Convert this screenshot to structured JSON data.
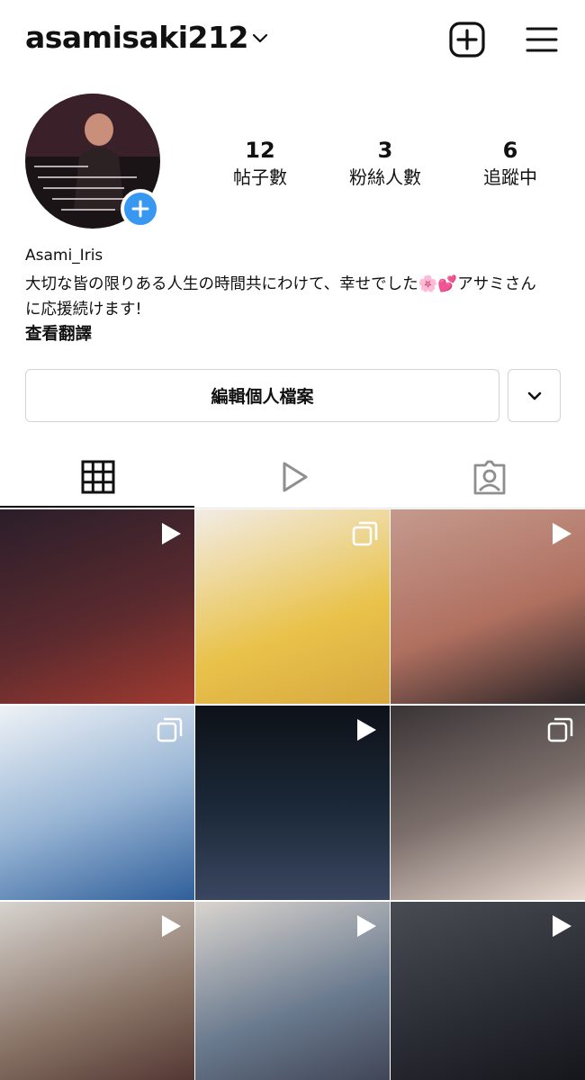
{
  "header": {
    "username": "asamisaki212",
    "icons": [
      "chevron-down-icon",
      "plus-square-icon",
      "hamburger-menu-icon"
    ]
  },
  "profile": {
    "display_name": "Asami_Iris",
    "bio_line1": "大切な皆の限りある人生の時間共にわけて、幸せでした🌸💕アサミさん",
    "bio_line2": "に応援続けます!",
    "translate_label": "查看翻譯",
    "stats": {
      "posts": {
        "value": "12",
        "label": "帖子數"
      },
      "followers": {
        "value": "3",
        "label": "粉絲人數"
      },
      "following": {
        "value": "6",
        "label": "追蹤中"
      }
    }
  },
  "actions": {
    "edit_label": "編輯個人檔案",
    "more_icon": "chevron-down-icon"
  },
  "tabs": [
    {
      "name": "posts-grid",
      "icon": "grid-icon",
      "active": true
    },
    {
      "name": "reels",
      "icon": "play-outline-icon",
      "active": false
    },
    {
      "name": "tagged",
      "icon": "tagged-person-icon",
      "active": false
    }
  ],
  "posts": [
    {
      "type": "video",
      "badge_icon": "play-icon",
      "bg": "#5a2a2e"
    },
    {
      "type": "carousel",
      "badge_icon": "carousel-icon",
      "bg": "#e9c24a"
    },
    {
      "type": "video",
      "badge_icon": "play-icon",
      "bg": "#b07060"
    },
    {
      "type": "carousel",
      "badge_icon": "carousel-icon",
      "bg": "#6f9bc9"
    },
    {
      "type": "video",
      "badge_icon": "play-icon",
      "bg": "#1c2a3a"
    },
    {
      "type": "carousel",
      "badge_icon": "carousel-icon",
      "bg": "#7b6e6a"
    },
    {
      "type": "video",
      "badge_icon": "play-icon",
      "bg": "#8a7568"
    },
    {
      "type": "video",
      "badge_icon": "play-icon",
      "bg": "#6a7a8e"
    },
    {
      "type": "video",
      "badge_icon": "play-icon",
      "bg": "#2a2c34"
    }
  ]
}
